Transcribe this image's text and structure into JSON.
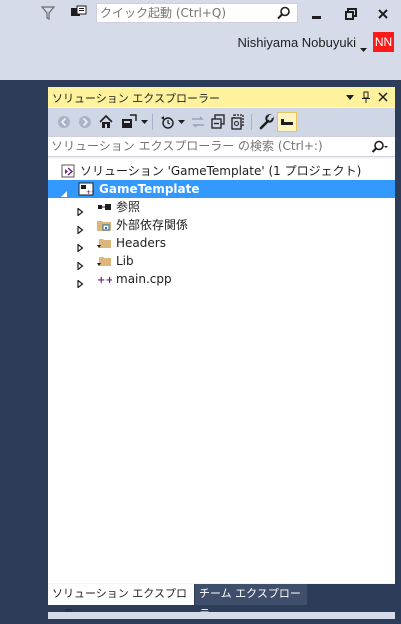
{
  "titlebar": {
    "quick_launch_placeholder": "クイック起動 (Ctrl+Q)",
    "user_name": "Nishiyama Nobuyuki",
    "user_initials": "NN",
    "minimize_icon": "minimize-icon",
    "restore_icon": "restore-icon",
    "close_icon": "close-icon"
  },
  "panel": {
    "title": "ソリューション エクスプローラー",
    "search_placeholder": "ソリューション エクスプローラー の検索 (Ctrl+:)",
    "tree": [
      {
        "label": "ソリューション 'GameTemplate' (1 プロジェクト)",
        "icon": "solution-icon"
      },
      {
        "label": "GameTemplate",
        "icon": "cpp-project-icon",
        "selected": true
      },
      {
        "label": "参照",
        "icon": "references-icon"
      },
      {
        "label": "外部依存関係",
        "icon": "external-deps-icon"
      },
      {
        "label": "Headers",
        "icon": "filter-folder-icon"
      },
      {
        "label": "Lib",
        "icon": "filter-folder-icon"
      },
      {
        "label": "main.cpp",
        "icon": "cpp-file-icon"
      }
    ]
  },
  "tabs": [
    {
      "label": "ソリューション エクスプローラー"
    },
    {
      "label": "チーム エクスプローラー"
    }
  ],
  "colors": {
    "accent": "#3399ff",
    "header_active": "#fff29d",
    "avatar": "#ff1a1a"
  }
}
